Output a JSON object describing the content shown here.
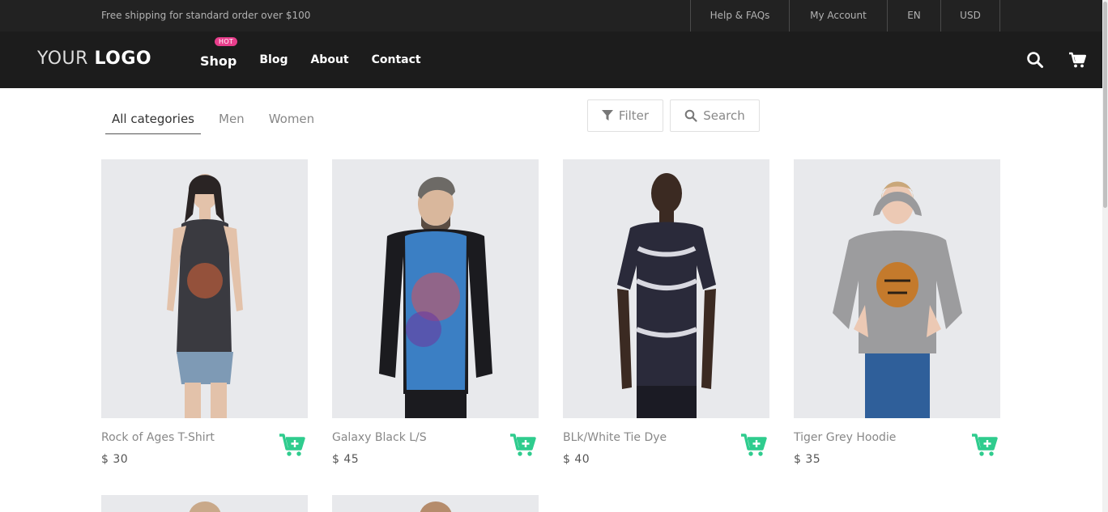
{
  "topbar": {
    "shipping_text": "Free shipping for standard order over $100",
    "links": [
      "Help & FAQs",
      "My Account",
      "EN",
      "USD"
    ]
  },
  "header": {
    "logo_light": "YOUR ",
    "logo_bold": "LOGO",
    "nav": [
      {
        "label": "Shop",
        "badge": "HOT"
      },
      {
        "label": "Blog"
      },
      {
        "label": "About"
      },
      {
        "label": "Contact"
      }
    ],
    "icons": [
      "search-icon",
      "cart-icon"
    ]
  },
  "filters": {
    "categories": [
      "All categories",
      "Men",
      "Women"
    ],
    "active_category": "All categories",
    "filter_label": "Filter",
    "search_label": "Search"
  },
  "products": [
    {
      "name": "Rock of Ages T-Shirt",
      "price": "$ 30"
    },
    {
      "name": "Galaxy Black L/S",
      "price": "$ 45"
    },
    {
      "name": "BLk/White Tie Dye",
      "price": "$ 40"
    },
    {
      "name": "Tiger Grey Hoodie",
      "price": "$ 35"
    }
  ],
  "colors": {
    "accent": "#2fcc8e",
    "topbar_bg": "#222222",
    "header_bg": "#1c1c1c",
    "hot_badge": "#e83e8c"
  }
}
